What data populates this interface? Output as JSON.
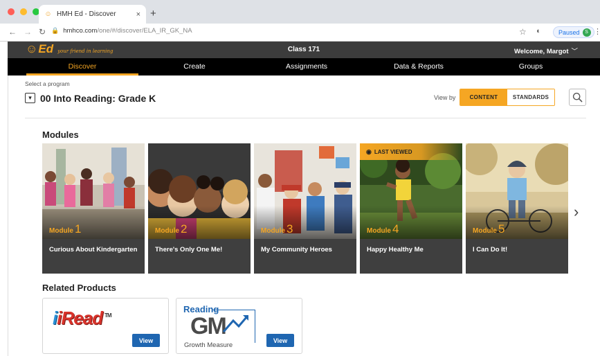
{
  "browser": {
    "tab_title": "HMH Ed - Discover",
    "tab_close": "×",
    "new_tab": "+",
    "url_domain": "hmhco.com",
    "url_path": "/one/#/discover/ELA_IR_GK_NA",
    "profile_status": "Paused",
    "profile_initial": "S"
  },
  "app": {
    "logo_text": "Ed",
    "logo_tagline": "your friend in learning",
    "class_name": "Class 171",
    "welcome": "Welcome, Margot",
    "nav": [
      "Discover",
      "Create",
      "Assignments",
      "Data & Reports",
      "Groups"
    ],
    "active_nav": "Discover"
  },
  "program": {
    "label": "Select a program",
    "value": "00 Into Reading: Grade K",
    "view_by_label": "View by",
    "view_options": [
      "CONTENT",
      "STANDARDS"
    ],
    "selected_view": "CONTENT"
  },
  "modules": {
    "heading": "Modules",
    "last_viewed_label": "LAST VIEWED",
    "module_word": "Module",
    "items": [
      {
        "number": "1",
        "title": "Curious About Kindergarten"
      },
      {
        "number": "2",
        "title": "There's Only One Me!"
      },
      {
        "number": "3",
        "title": "My Community Heroes"
      },
      {
        "number": "4",
        "title": "Happy Healthy Me",
        "last_viewed": true
      },
      {
        "number": "5",
        "title": "I Can Do It!"
      }
    ]
  },
  "related": {
    "heading": "Related Products",
    "products": [
      {
        "name": "iRead",
        "trademark": "TM",
        "button": "View"
      },
      {
        "name_top": "Reading",
        "name_mark": "GM",
        "name_sub": "Growth Measure",
        "button": "View"
      }
    ]
  },
  "colors": {
    "accent": "#f5a623",
    "header_bg": "#3c3c3c",
    "nav_bg": "#000000",
    "button_blue": "#1f66b1"
  }
}
